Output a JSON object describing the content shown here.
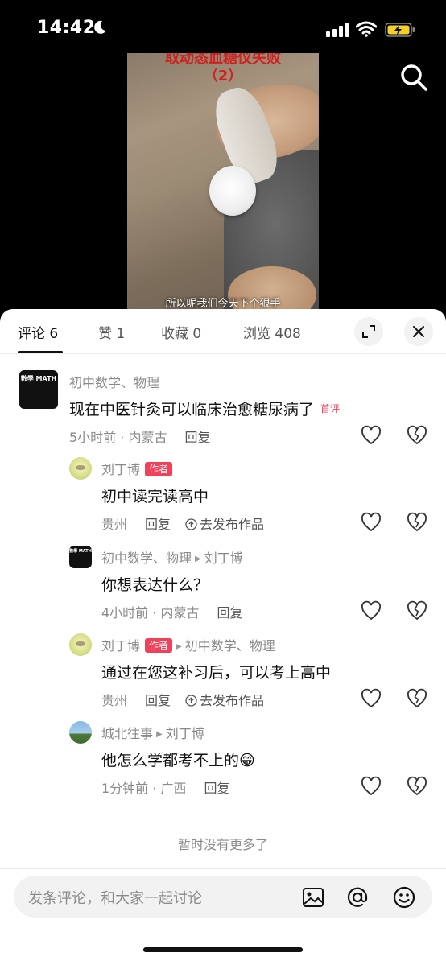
{
  "status_bar": {
    "time": "14:42",
    "battery_color": "#f5d02a"
  },
  "video": {
    "title_line1": "取动态血糖仪失败",
    "title_line2": "（2）",
    "subtitle": "所以呢我们今天下个狠手"
  },
  "tabs": [
    {
      "label": "评论 6",
      "active": true
    },
    {
      "label": "赞 1"
    },
    {
      "label": "收藏 0"
    },
    {
      "label": "浏览 408"
    }
  ],
  "comments": [
    {
      "author": "初中数学、物理",
      "text": "现在中医针灸可以临床治愈糖尿病了",
      "badge": "首评",
      "time_location": "5小时前 · 内蒙古",
      "reply_label": "回复",
      "avatar_text": "數學 MATH"
    },
    {
      "author": "刘丁博",
      "author_badge": "作者",
      "text": "初中读完读高中",
      "time_location": "贵州",
      "reply_label": "回复",
      "publish_label": "去发布作品"
    },
    {
      "author": "初中数学、物理",
      "reply_to": "刘丁博",
      "text": "你想表达什么？",
      "time_location": "4小时前 · 内蒙古",
      "reply_label": "回复",
      "avatar_text": "數學 MATH"
    },
    {
      "author": "刘丁博",
      "author_badge": "作者",
      "reply_to": "初中数学、物理",
      "text": "通过在您这补习后，可以考上高中",
      "time_location": "贵州",
      "reply_label": "回复",
      "publish_label": "去发布作品"
    },
    {
      "author": "城北往事",
      "reply_to": "刘丁博",
      "text": "他怎么学都考不上的😁",
      "time_location": "1分钟前 · 广西",
      "reply_label": "回复"
    }
  ],
  "no_more_text": "暂时没有更多了",
  "input": {
    "placeholder": "发条评论，和大家一起讨论"
  },
  "colors": {
    "accent": "#f0405a"
  }
}
